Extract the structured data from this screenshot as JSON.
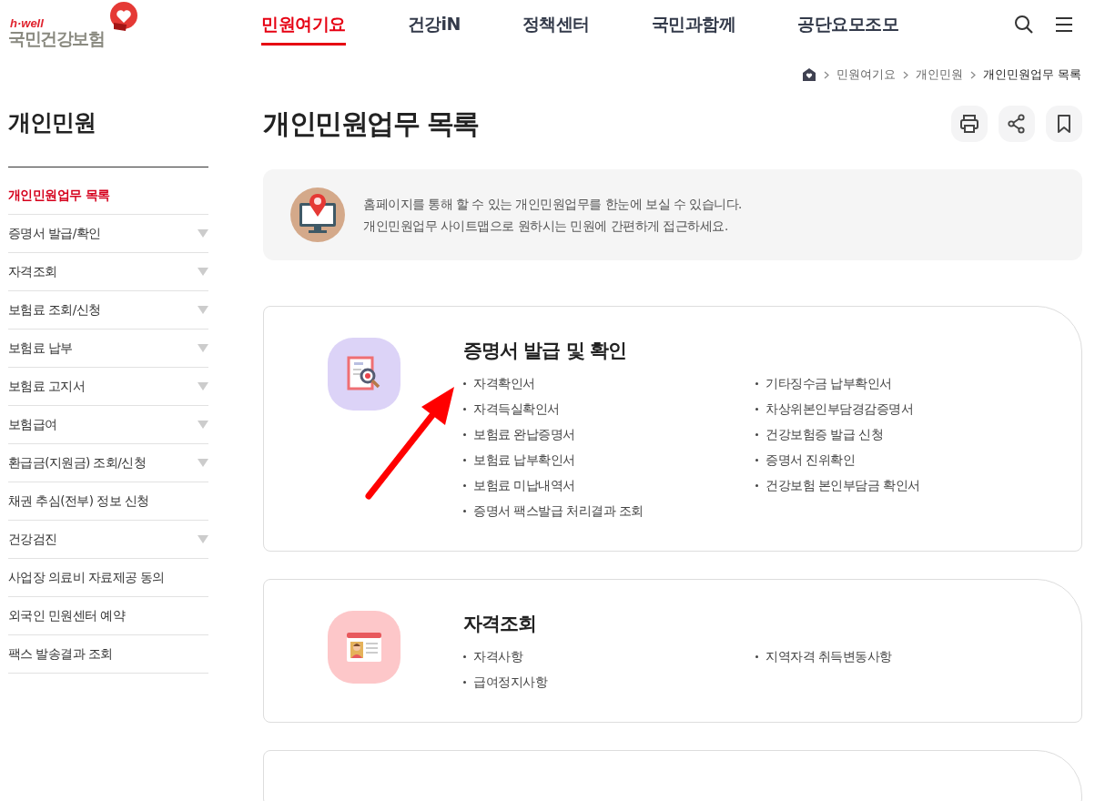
{
  "logo": {
    "tagline": "h·well",
    "name": "국민건강보험"
  },
  "nav": [
    {
      "label": "민원여기요",
      "selected": true
    },
    {
      "label": "건강iN",
      "selected": false
    },
    {
      "label": "정책센터",
      "selected": false
    },
    {
      "label": "국민과함께",
      "selected": false
    },
    {
      "label": "공단요모조모",
      "selected": false
    }
  ],
  "breadcrumb": [
    "민원여기요",
    "개인민원",
    "개인민원업무 목록"
  ],
  "sidebar": {
    "title": "개인민원",
    "items": [
      {
        "label": "개인민원업무 목록",
        "selected": true,
        "expandable": false
      },
      {
        "label": "증명서 발급/확인",
        "selected": false,
        "expandable": true
      },
      {
        "label": "자격조회",
        "selected": false,
        "expandable": true
      },
      {
        "label": "보험료 조회/신청",
        "selected": false,
        "expandable": true
      },
      {
        "label": "보험료 납부",
        "selected": false,
        "expandable": true
      },
      {
        "label": "보험료 고지서",
        "selected": false,
        "expandable": true
      },
      {
        "label": "보험급여",
        "selected": false,
        "expandable": true
      },
      {
        "label": "환급금(지원금) 조회/신청",
        "selected": false,
        "expandable": true
      },
      {
        "label": "채권 추심(전부) 정보 신청",
        "selected": false,
        "expandable": false
      },
      {
        "label": "건강검진",
        "selected": false,
        "expandable": true
      },
      {
        "label": "사업장 의료비 자료제공 동의",
        "selected": false,
        "expandable": false
      },
      {
        "label": "외국인 민원센터 예약",
        "selected": false,
        "expandable": false
      },
      {
        "label": "팩스 발송결과 조회",
        "selected": false,
        "expandable": false
      }
    ]
  },
  "page_title": "개인민원업무 목록",
  "info": [
    "홈페이지를 통해 할 수 있는 개인민원업무를 한눈에 보실 수 있습니다.",
    "개인민원업무 사이트맵으로 원하시는 민원에 간편하게 접근하세요."
  ],
  "cards": [
    {
      "kind": "certificate",
      "title": "증명서 발급 및 확인",
      "columns": [
        [
          "자격확인서",
          "자격득실확인서",
          "보험료 완납증명서",
          "보험료 납부확인서",
          "보험료 미납내역서",
          "증명서 팩스발급 처리결과 조회"
        ],
        [
          "기타징수금 납부확인서",
          "차상위본인부담경감증명서",
          "건강보험증 발급 신청",
          "증명서 진위확인",
          "건강보험 본인부담금 확인서"
        ]
      ]
    },
    {
      "kind": "id-card",
      "title": "자격조회",
      "columns": [
        [
          "자격사항",
          "급여정지사항"
        ],
        [
          "지역자격 취득변동사항"
        ]
      ]
    },
    {
      "kind": "partial"
    }
  ]
}
